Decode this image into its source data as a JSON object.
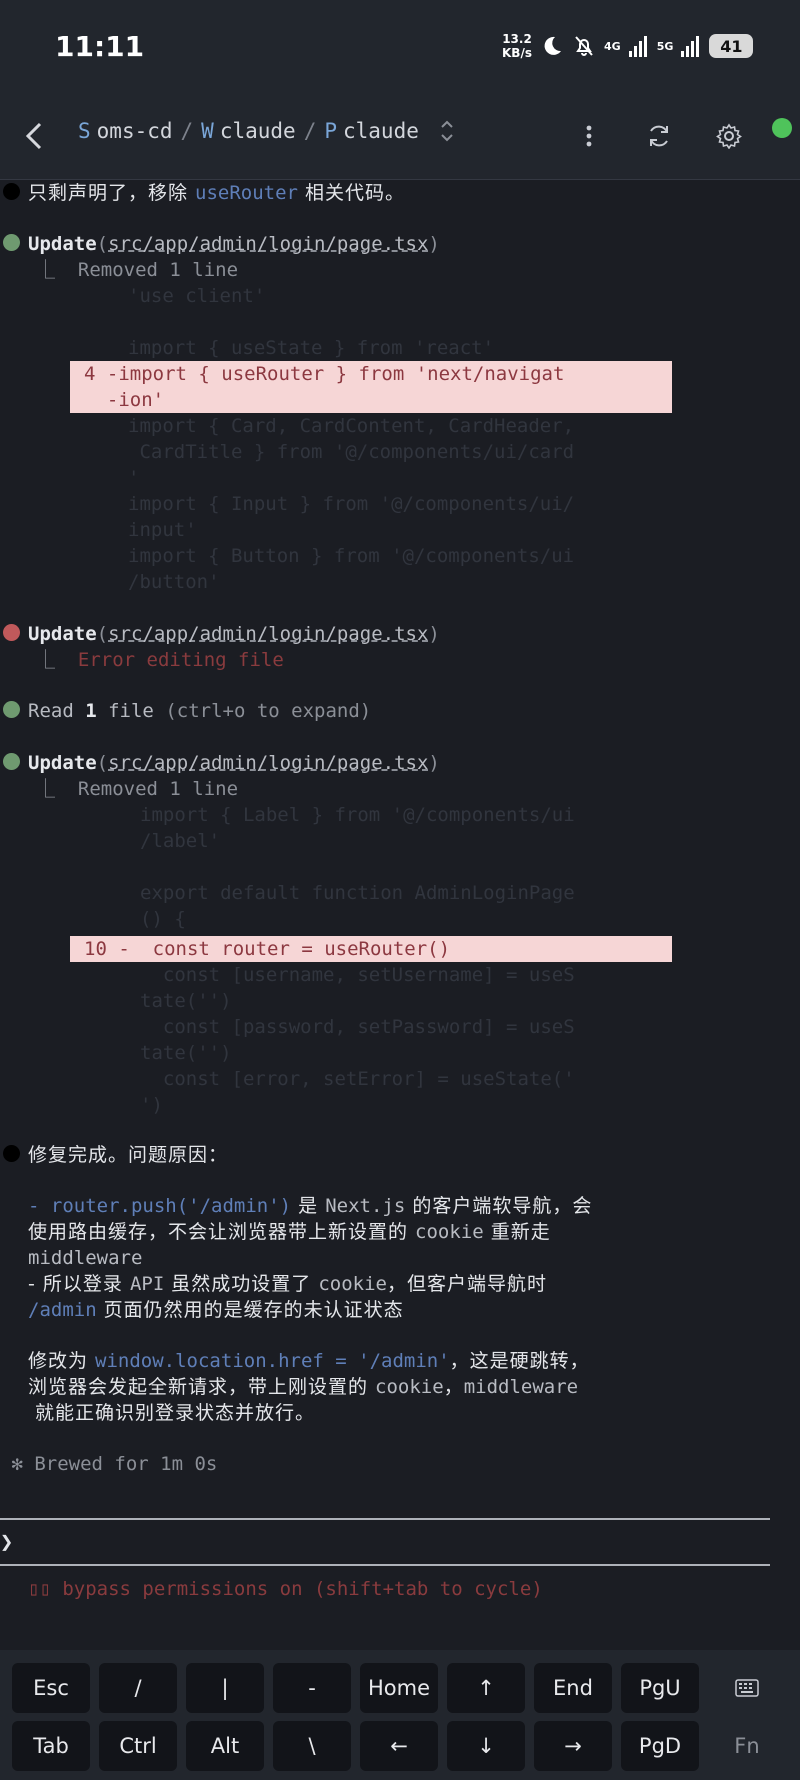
{
  "status": {
    "time": "11:11",
    "speed_value": "13.2",
    "speed_unit": "KB/s",
    "net1": "4G",
    "net2": "5G",
    "battery": "41"
  },
  "header": {
    "breadcrumbs": [
      {
        "letter": "S",
        "name": "oms-cd"
      },
      {
        "letter": "W",
        "name": "claude"
      },
      {
        "letter": "P",
        "name": "claude"
      }
    ],
    "separator": "/"
  },
  "term": {
    "l1_text": "只剩声明了，移除 ",
    "l1_code": "useRouter",
    "l1_tail": " 相关代码。",
    "upd1_tool": "Update",
    "upd1_path": "src/app/admin/login/page.tsx",
    "upd1_result": "Removed 1 line",
    "d1": [
      "'use client'",
      "import { useState } from 'react'",
      "4 -import { useRouter } from 'next/navigat",
      "  -ion'",
      "import { Card, CardContent, CardHeader,",
      " CardTitle } from '@/components/ui/card",
      "'",
      "import { Input } from '@/components/ui/",
      "input'",
      "import { Button } from '@/components/ui",
      "/button'"
    ],
    "upd2_tool": "Update",
    "upd2_path": "src/app/admin/login/page.tsx",
    "upd2_result": "Error editing file",
    "read_tool": "Read",
    "read_count": "1",
    "read_rest": " file ",
    "read_hint": "(ctrl+o to expand)",
    "upd3_tool": "Update",
    "upd3_path": "src/app/admin/login/page.tsx",
    "upd3_result": "Removed 1 line",
    "d2": [
      "import { Label } from '@/components/ui",
      "/label'",
      "export default function AdminLoginPage",
      "() {",
      "10 -  const router = useRouter()",
      "  const [username, setUsername] = useS",
      "tate('')",
      "  const [password, setPassword] = useS",
      "tate('')",
      "  const [error, setError] = useState('",
      "')"
    ],
    "fix_title": "修复完成。问题原因：",
    "p1_dash": "- ",
    "p1_code": "router.push('/admin')",
    "p1_a": " 是 ",
    "p1_b": "Next.js",
    "p1_c": " 的客户端软导航，会",
    "p1_line2a": "使用路由缓存，不会让浏览器带上新设置的 ",
    "p1_line2b": "cookie",
    "p1_line2c": " 重新走",
    "p1_line3": "middleware",
    "p2_a": "- 所以登录 ",
    "p2_b": "API",
    "p2_c": " 虽然成功设置了 ",
    "p2_d": "cookie",
    "p2_e": "，但客户端导航时",
    "p2_line2a": "/admin",
    "p2_line2b": " 页面仍然用的是缓存的未认证状态",
    "p3_a": "修改为 ",
    "p3_code": "window.location.href = '/admin'",
    "p3_b": "，这是硬跳转，",
    "p3_line2a": "浏览器会发起全新请求，带上刚设置的 ",
    "p3_line2b": "cookie",
    "p3_line2c": "，",
    "p3_line2d": "middleware",
    "p3_line3": " 就能正确识别登录状态并放行。",
    "brewed": "Brewed for 1m 0s",
    "prompt": "❯",
    "bypass": "▯▯ bypass permissions on (shift+tab to cycle)"
  },
  "keys": {
    "row1": [
      "Esc",
      "/",
      "|",
      "-",
      "Home",
      "↑",
      "End",
      "PgU"
    ],
    "row2": [
      "Tab",
      "Ctrl",
      "Alt",
      "\\",
      "←",
      "↓",
      "→",
      "PgD",
      "Fn"
    ]
  },
  "colors": {
    "online": "#4fc35b",
    "diff_removed_bg": "#f6d6d6",
    "error_bullet": "#c0595b",
    "ok_bullet": "#6f9a70"
  }
}
